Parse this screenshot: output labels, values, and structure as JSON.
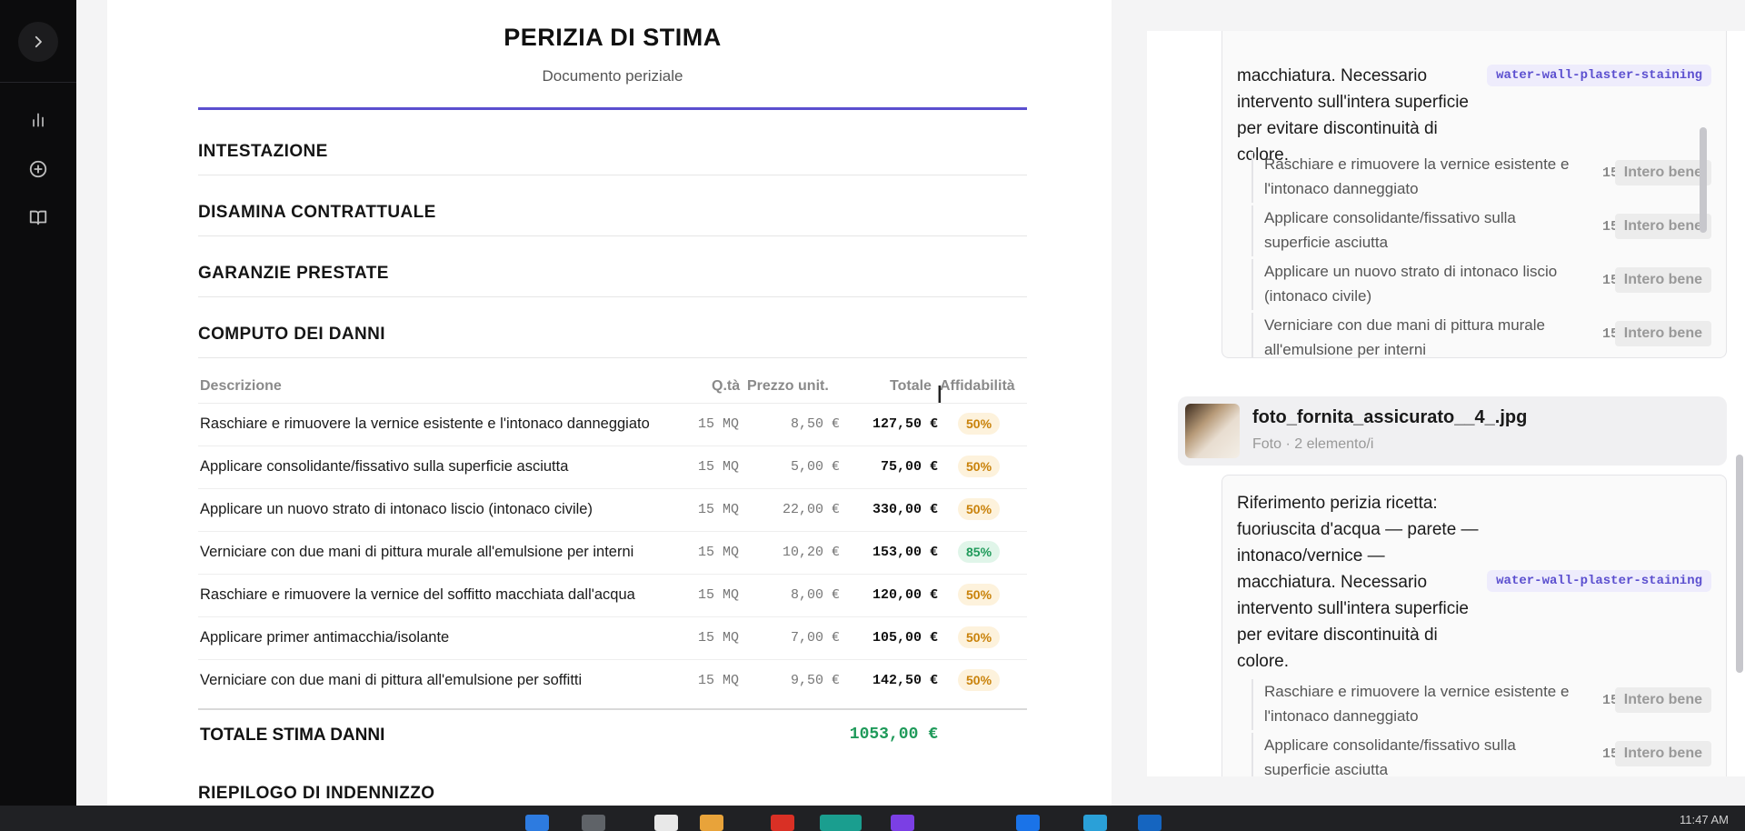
{
  "sidebar": {
    "toggle_icon": "chevron-right-icon",
    "icons": [
      "bar-chart-icon",
      "plus-circle-icon",
      "book-open-icon"
    ]
  },
  "document": {
    "title": "PERIZIA DI STIMA",
    "subtitle": "Documento periziale",
    "sections": [
      "INTESTAZIONE",
      "DISAMINA CONTRATTUALE",
      "GARANZIE PRESTATE",
      "COMPUTO DEI DANNI"
    ],
    "table": {
      "headers": {
        "desc": "Descrizione",
        "qty": "Q.tà",
        "price": "Prezzo unit.",
        "total": "Totale",
        "reliability": "Affidabilità"
      },
      "rows": [
        {
          "desc": "Raschiare e rimuovere la vernice esistente e l'intonaco danneggiato",
          "qty": "15 MQ",
          "price": "8,50 €",
          "total": "127,50 €",
          "reliability": "50%"
        },
        {
          "desc": "Applicare consolidante/fissativo sulla superficie asciutta",
          "qty": "15 MQ",
          "price": "5,00 €",
          "total": "75,00 €",
          "reliability": "50%"
        },
        {
          "desc": "Applicare un nuovo strato di intonaco liscio (intonaco civile)",
          "qty": "15 MQ",
          "price": "22,00 €",
          "total": "330,00 €",
          "reliability": "50%"
        },
        {
          "desc": "Verniciare con due mani di pittura murale all'emulsione per interni",
          "qty": "15 MQ",
          "price": "10,20 €",
          "total": "153,00 €",
          "reliability": "85%"
        },
        {
          "desc": "Raschiare e rimuovere la vernice del soffitto macchiata dall'acqua",
          "qty": "15 MQ",
          "price": "8,00 €",
          "total": "120,00 €",
          "reliability": "50%"
        },
        {
          "desc": "Applicare primer antimacchia/isolante",
          "qty": "15 MQ",
          "price": "7,00 €",
          "total": "105,00 €",
          "reliability": "50%"
        },
        {
          "desc": "Verniciare con due mani di pittura all'emulsione per soffitti",
          "qty": "15 MQ",
          "price": "9,50 €",
          "total": "142,50 €",
          "reliability": "50%"
        }
      ]
    },
    "total_label": "TOTALE STIMA DANNI",
    "total_value": "1053,00 €",
    "next_section": "RIEPILOGO DI INDENNIZZO"
  },
  "panel": {
    "card1": {
      "text_lines": [
        "macchiatura. Necessario",
        "intervento sull'intera superficie",
        "per evitare discontinuità di",
        "colore."
      ],
      "tag": "water-wall-plaster-staining",
      "items": [
        {
          "text": "Raschiare e rimuovere la vernice esistente e l'intonaco danneggiato",
          "qty": "15 MQ",
          "scope": "Intero bene"
        },
        {
          "text": "Applicare consolidante/fissativo sulla superficie asciutta",
          "qty": "15 MQ",
          "scope": "Intero bene"
        },
        {
          "text": "Applicare un nuovo strato di intonaco liscio (intonaco civile)",
          "qty": "15 MQ",
          "scope": "Intero bene"
        },
        {
          "text": "Verniciare con due mani di pittura murale all'emulsione per interni",
          "qty": "15 MQ",
          "scope": "Intero bene"
        }
      ]
    },
    "photo": {
      "name": "foto_fornita_assicurato__4_.jpg",
      "meta": "Foto · 2 elemento/i"
    },
    "card2": {
      "text_lines": [
        "Riferimento perizia ricetta:",
        "fuoriuscita d'acqua — parete —",
        "intonaco/vernice —",
        "macchiatura. Necessario",
        "intervento sull'intera superficie",
        "per evitare discontinuità di",
        "colore."
      ],
      "tag": "water-wall-plaster-staining",
      "items": [
        {
          "text": "Raschiare e rimuovere la vernice esistente e l'intonaco danneggiato",
          "qty": "15 MQ",
          "scope": "Intero bene"
        },
        {
          "text": "Applicare consolidante/fissativo sulla superficie asciutta",
          "qty": "15 MQ",
          "scope": "Intero bene"
        }
      ]
    }
  },
  "taskbar": {
    "clock": "11:47 AM"
  }
}
